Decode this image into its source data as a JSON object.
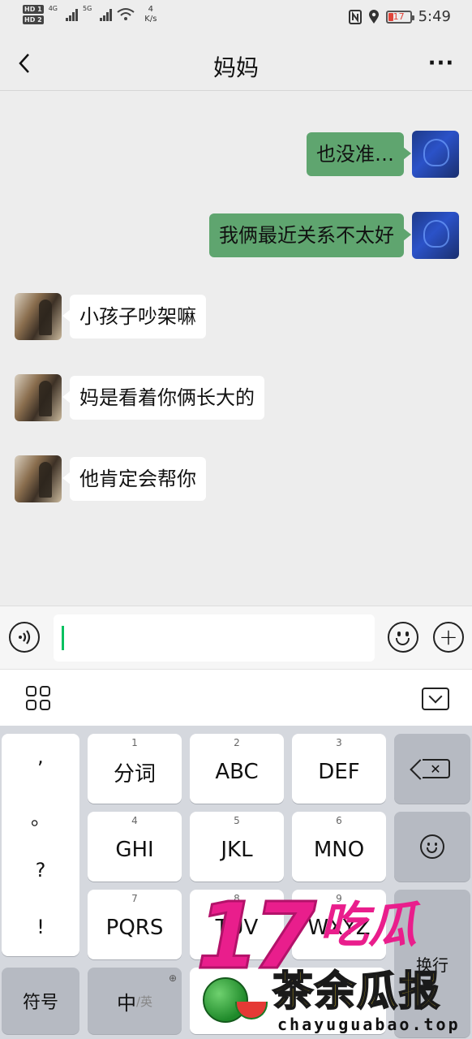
{
  "status_bar": {
    "hd1": "HD 1",
    "hd2": "HD 2",
    "net1": "4G",
    "net2": "5G",
    "speed_value": "4",
    "speed_unit": "K/s",
    "battery": "17",
    "time": "5:49"
  },
  "header": {
    "title": "妈妈",
    "more": "···"
  },
  "messages": [
    {
      "from": "me",
      "text": "也没准…"
    },
    {
      "from": "me",
      "text": "我俩最近关系不太好"
    },
    {
      "from": "them",
      "text": "小孩子吵架嘛"
    },
    {
      "from": "them",
      "text": "妈是看着你俩长大的"
    },
    {
      "from": "them",
      "text": "他肯定会帮你"
    }
  ],
  "input": {
    "value": ""
  },
  "keyboard": {
    "punct": [
      ",",
      "。",
      "?",
      "!"
    ],
    "keys": [
      {
        "num": "1",
        "label": "分词"
      },
      {
        "num": "2",
        "label": "ABC"
      },
      {
        "num": "3",
        "label": "DEF"
      },
      {
        "num": "4",
        "label": "GHI"
      },
      {
        "num": "5",
        "label": "JKL"
      },
      {
        "num": "6",
        "label": "MNO"
      },
      {
        "num": "7",
        "label": "PQRS"
      },
      {
        "num": "8",
        "label": "TUV"
      },
      {
        "num": "9",
        "label": "WXYZ"
      }
    ],
    "symbols": "符号",
    "lang_main": "中",
    "lang_sub": "/英",
    "enter": "换行"
  },
  "watermark": {
    "big": "17",
    "chihu": "吃瓜",
    "brand": "茶余瓜报",
    "url": "chayuguabao.top"
  }
}
